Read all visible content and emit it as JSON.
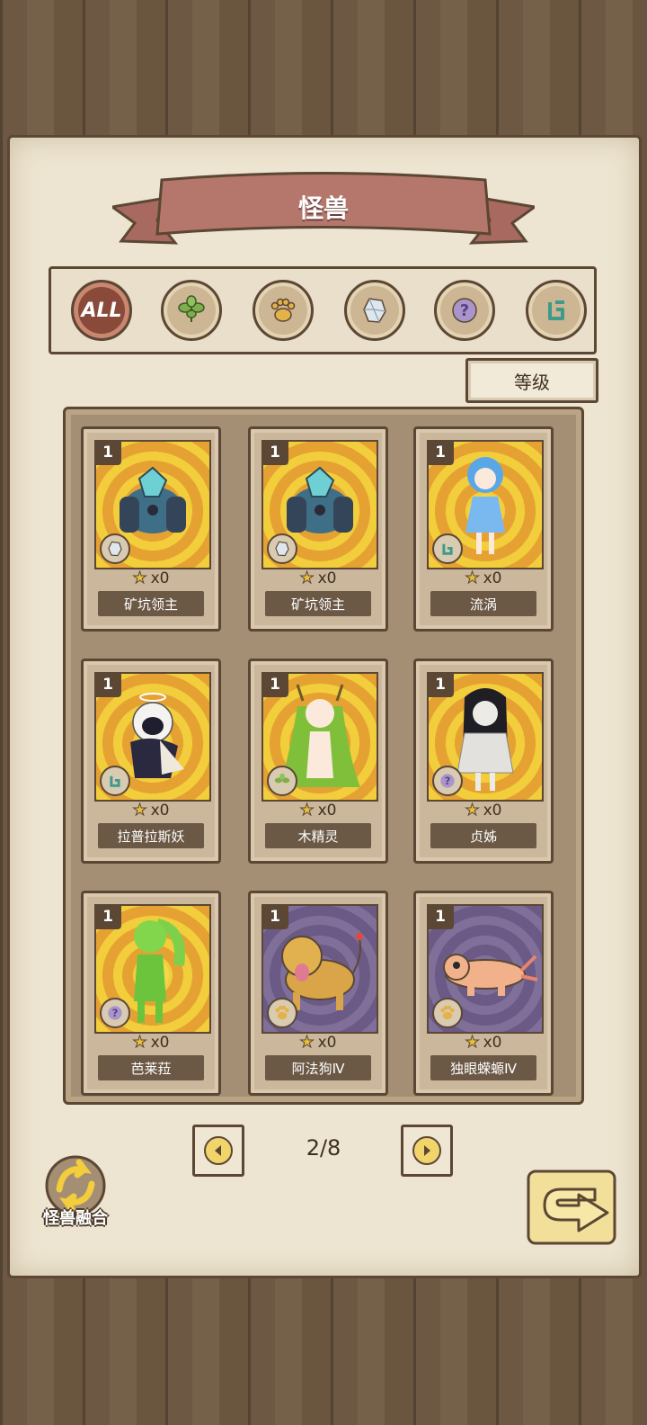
{
  "header": {
    "title": "怪兽"
  },
  "filters": [
    {
      "id": "all",
      "label": "ALL",
      "icon": "all-icon",
      "active": true
    },
    {
      "id": "plant",
      "icon": "leaf-icon"
    },
    {
      "id": "beast",
      "icon": "paw-icon"
    },
    {
      "id": "mineral",
      "icon": "crystal-icon"
    },
    {
      "id": "unknown",
      "icon": "question-icon"
    },
    {
      "id": "spirit",
      "icon": "rune-icon"
    }
  ],
  "sort": {
    "label": "等级"
  },
  "monsters": [
    {
      "level": "1",
      "stars": "x0",
      "name": "矿坑领主",
      "type": "crystal-icon",
      "bg": "gold"
    },
    {
      "level": "1",
      "stars": "x0",
      "name": "矿坑领主",
      "type": "crystal-icon",
      "bg": "gold"
    },
    {
      "level": "1",
      "stars": "x0",
      "name": "流涡",
      "type": "rune-icon",
      "bg": "gold"
    },
    {
      "level": "1",
      "stars": "x0",
      "name": "拉普拉斯妖",
      "type": "rune-icon",
      "bg": "gold"
    },
    {
      "level": "1",
      "stars": "x0",
      "name": "木精灵",
      "type": "leaf-icon",
      "bg": "gold"
    },
    {
      "level": "1",
      "stars": "x0",
      "name": "贞姊",
      "type": "question-icon",
      "bg": "gold"
    },
    {
      "level": "1",
      "stars": "x0",
      "name": "芭莱菈",
      "type": "question-icon",
      "bg": "gold"
    },
    {
      "level": "1",
      "stars": "x0",
      "name": "阿法狗Ⅳ",
      "type": "paw-icon",
      "bg": "purple"
    },
    {
      "level": "1",
      "stars": "x0",
      "name": "独眼蝾螈Ⅳ",
      "type": "paw-icon",
      "bg": "purple"
    }
  ],
  "pagination": {
    "current": "2/8"
  },
  "fusion": {
    "label": "怪兽融合"
  },
  "colors": {
    "wood": "#6e5a44",
    "parchment": "#ede5d1",
    "ribbon": "#b5776c",
    "outline": "#5b4734",
    "gold": "#f2cd3c",
    "purple": "#7f6f99"
  }
}
